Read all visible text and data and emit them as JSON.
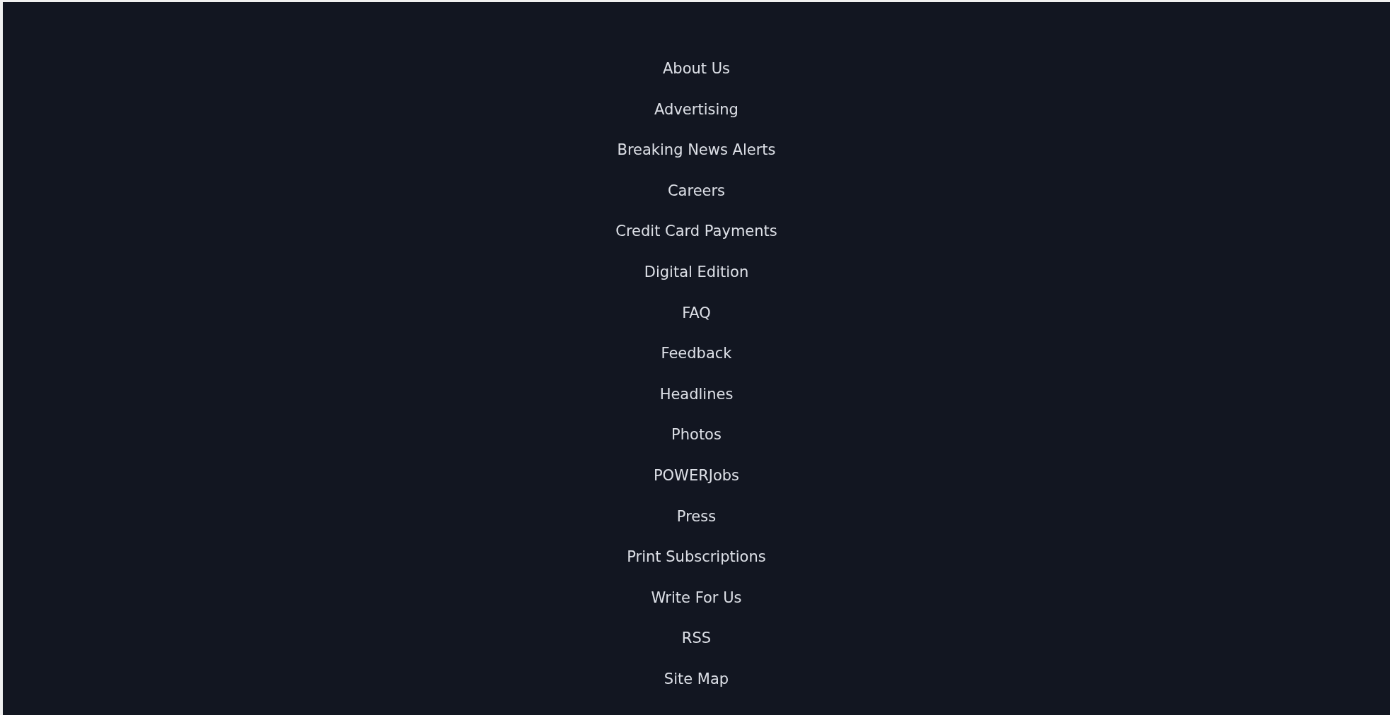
{
  "footer_links": [
    {
      "label": "About Us"
    },
    {
      "label": "Advertising"
    },
    {
      "label": "Breaking News Alerts"
    },
    {
      "label": "Careers"
    },
    {
      "label": "Credit Card Payments"
    },
    {
      "label": "Digital Edition"
    },
    {
      "label": "FAQ"
    },
    {
      "label": "Feedback"
    },
    {
      "label": "Headlines"
    },
    {
      "label": "Photos"
    },
    {
      "label": "POWERJobs"
    },
    {
      "label": "Press"
    },
    {
      "label": "Print Subscriptions"
    },
    {
      "label": "Write For Us"
    },
    {
      "label": "RSS"
    },
    {
      "label": "Site Map"
    }
  ]
}
